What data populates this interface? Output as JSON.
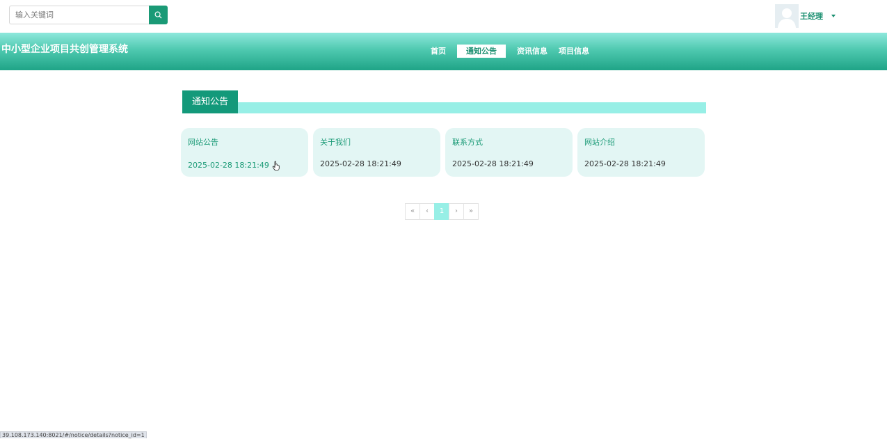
{
  "search": {
    "placeholder": "输入关键词"
  },
  "user": {
    "name": "王经理"
  },
  "header": {
    "title": "中小型企业项目共创管理系统",
    "nav": [
      {
        "label": "首页",
        "active": false
      },
      {
        "label": "通知公告",
        "active": true
      },
      {
        "label": "资讯信息",
        "active": false
      },
      {
        "label": "项目信息",
        "active": false
      }
    ]
  },
  "section": {
    "title": "通知公告"
  },
  "notices": [
    {
      "title": "网站公告",
      "date": "2025-02-28 18:21:49"
    },
    {
      "title": "关于我们",
      "date": "2025-02-28 18:21:49"
    },
    {
      "title": "联系方式",
      "date": "2025-02-28 18:21:49"
    },
    {
      "title": "网站介绍",
      "date": "2025-02-28 18:21:49"
    }
  ],
  "pagination": {
    "first": "«",
    "prev": "‹",
    "current": "1",
    "next": "›",
    "last": "»"
  },
  "status_url": "39.108.173.140:8021/#/notice/details?notice_id=1",
  "colors": {
    "accent": "#1a9a76",
    "light_accent": "#97efe6",
    "card_bg": "#e3f6f4"
  },
  "icons": {
    "search": "search-icon",
    "avatar": "user-avatar-icon",
    "caret": "caret-down-icon",
    "cursor": "hand-cursor-icon"
  }
}
